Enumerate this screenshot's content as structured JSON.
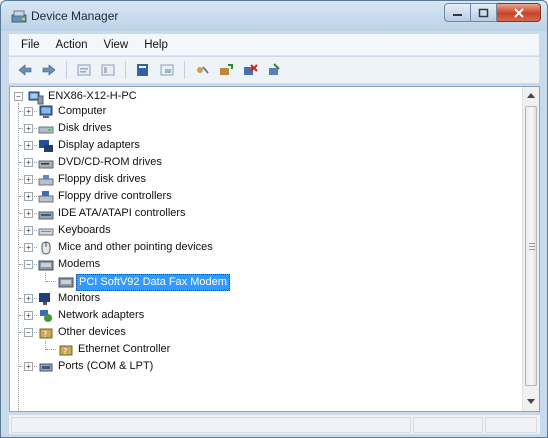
{
  "window": {
    "title": "Device Manager",
    "icon": "device-manager-icon",
    "controls": [
      "minimize",
      "maximize",
      "close"
    ]
  },
  "menu": [
    "File",
    "Action",
    "View",
    "Help"
  ],
  "toolbar": [
    "back-icon",
    "forward-icon",
    "properties-icon",
    "help-icon",
    "show-hidden-icon",
    "computer-view-icon",
    "scan-hardware-icon",
    "update-driver-icon",
    "disable-device-icon",
    "uninstall-device-icon"
  ],
  "tree": {
    "root": "ENX86-X12-H-PC",
    "items": [
      {
        "label": "Computer",
        "icon": "computer-icon"
      },
      {
        "label": "Disk drives",
        "icon": "disk-drive-icon"
      },
      {
        "label": "Display adapters",
        "icon": "display-adapter-icon"
      },
      {
        "label": "DVD/CD-ROM drives",
        "icon": "dvd-drive-icon"
      },
      {
        "label": "Floppy disk drives",
        "icon": "floppy-icon"
      },
      {
        "label": "Floppy drive controllers",
        "icon": "floppy-controller-icon"
      },
      {
        "label": "IDE ATA/ATAPI controllers",
        "icon": "ide-controller-icon"
      },
      {
        "label": "Keyboards",
        "icon": "keyboard-icon"
      },
      {
        "label": "Mice and other pointing devices",
        "icon": "mouse-icon"
      },
      {
        "label": "Modems",
        "icon": "modem-icon",
        "expanded": true,
        "children": [
          {
            "label": "PCI SoftV92 Data Fax Modem",
            "icon": "modem-icon",
            "selected": true
          }
        ]
      },
      {
        "label": "Monitors",
        "icon": "monitor-icon"
      },
      {
        "label": "Network adapters",
        "icon": "network-adapter-icon"
      },
      {
        "label": "Other devices",
        "icon": "unknown-device-icon",
        "expanded": true,
        "children": [
          {
            "label": "Ethernet Controller",
            "icon": "unknown-device-icon"
          }
        ]
      },
      {
        "label": "Ports (COM & LPT)",
        "icon": "port-icon"
      }
    ]
  },
  "colors": {
    "selection": "#3399ff",
    "frame": "#c9dbea"
  }
}
